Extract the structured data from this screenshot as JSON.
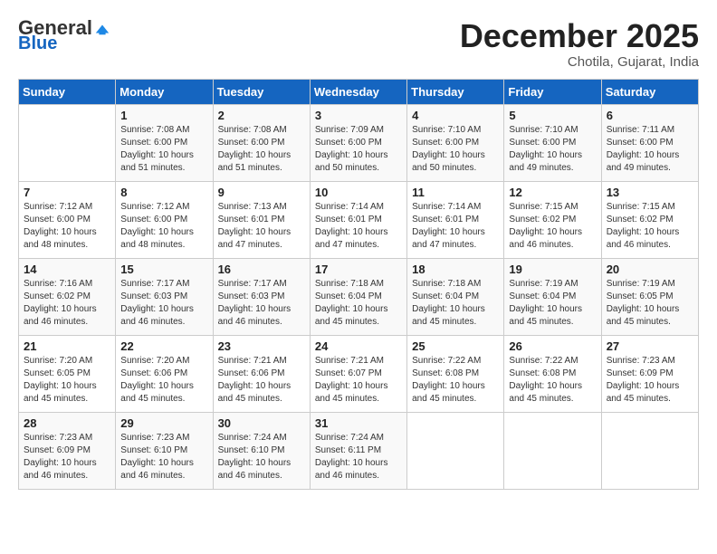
{
  "header": {
    "logo_general": "General",
    "logo_blue": "Blue",
    "month": "December 2025",
    "location": "Chotila, Gujarat, India"
  },
  "weekdays": [
    "Sunday",
    "Monday",
    "Tuesday",
    "Wednesday",
    "Thursday",
    "Friday",
    "Saturday"
  ],
  "weeks": [
    [
      {
        "day": "",
        "sunrise": "",
        "sunset": "",
        "daylight": ""
      },
      {
        "day": "1",
        "sunrise": "7:08 AM",
        "sunset": "6:00 PM",
        "daylight": "10 hours and 51 minutes."
      },
      {
        "day": "2",
        "sunrise": "7:08 AM",
        "sunset": "6:00 PM",
        "daylight": "10 hours and 51 minutes."
      },
      {
        "day": "3",
        "sunrise": "7:09 AM",
        "sunset": "6:00 PM",
        "daylight": "10 hours and 50 minutes."
      },
      {
        "day": "4",
        "sunrise": "7:10 AM",
        "sunset": "6:00 PM",
        "daylight": "10 hours and 50 minutes."
      },
      {
        "day": "5",
        "sunrise": "7:10 AM",
        "sunset": "6:00 PM",
        "daylight": "10 hours and 49 minutes."
      },
      {
        "day": "6",
        "sunrise": "7:11 AM",
        "sunset": "6:00 PM",
        "daylight": "10 hours and 49 minutes."
      }
    ],
    [
      {
        "day": "7",
        "sunrise": "7:12 AM",
        "sunset": "6:00 PM",
        "daylight": "10 hours and 48 minutes."
      },
      {
        "day": "8",
        "sunrise": "7:12 AM",
        "sunset": "6:00 PM",
        "daylight": "10 hours and 48 minutes."
      },
      {
        "day": "9",
        "sunrise": "7:13 AM",
        "sunset": "6:01 PM",
        "daylight": "10 hours and 47 minutes."
      },
      {
        "day": "10",
        "sunrise": "7:14 AM",
        "sunset": "6:01 PM",
        "daylight": "10 hours and 47 minutes."
      },
      {
        "day": "11",
        "sunrise": "7:14 AM",
        "sunset": "6:01 PM",
        "daylight": "10 hours and 47 minutes."
      },
      {
        "day": "12",
        "sunrise": "7:15 AM",
        "sunset": "6:02 PM",
        "daylight": "10 hours and 46 minutes."
      },
      {
        "day": "13",
        "sunrise": "7:15 AM",
        "sunset": "6:02 PM",
        "daylight": "10 hours and 46 minutes."
      }
    ],
    [
      {
        "day": "14",
        "sunrise": "7:16 AM",
        "sunset": "6:02 PM",
        "daylight": "10 hours and 46 minutes."
      },
      {
        "day": "15",
        "sunrise": "7:17 AM",
        "sunset": "6:03 PM",
        "daylight": "10 hours and 46 minutes."
      },
      {
        "day": "16",
        "sunrise": "7:17 AM",
        "sunset": "6:03 PM",
        "daylight": "10 hours and 46 minutes."
      },
      {
        "day": "17",
        "sunrise": "7:18 AM",
        "sunset": "6:04 PM",
        "daylight": "10 hours and 45 minutes."
      },
      {
        "day": "18",
        "sunrise": "7:18 AM",
        "sunset": "6:04 PM",
        "daylight": "10 hours and 45 minutes."
      },
      {
        "day": "19",
        "sunrise": "7:19 AM",
        "sunset": "6:04 PM",
        "daylight": "10 hours and 45 minutes."
      },
      {
        "day": "20",
        "sunrise": "7:19 AM",
        "sunset": "6:05 PM",
        "daylight": "10 hours and 45 minutes."
      }
    ],
    [
      {
        "day": "21",
        "sunrise": "7:20 AM",
        "sunset": "6:05 PM",
        "daylight": "10 hours and 45 minutes."
      },
      {
        "day": "22",
        "sunrise": "7:20 AM",
        "sunset": "6:06 PM",
        "daylight": "10 hours and 45 minutes."
      },
      {
        "day": "23",
        "sunrise": "7:21 AM",
        "sunset": "6:06 PM",
        "daylight": "10 hours and 45 minutes."
      },
      {
        "day": "24",
        "sunrise": "7:21 AM",
        "sunset": "6:07 PM",
        "daylight": "10 hours and 45 minutes."
      },
      {
        "day": "25",
        "sunrise": "7:22 AM",
        "sunset": "6:08 PM",
        "daylight": "10 hours and 45 minutes."
      },
      {
        "day": "26",
        "sunrise": "7:22 AM",
        "sunset": "6:08 PM",
        "daylight": "10 hours and 45 minutes."
      },
      {
        "day": "27",
        "sunrise": "7:23 AM",
        "sunset": "6:09 PM",
        "daylight": "10 hours and 45 minutes."
      }
    ],
    [
      {
        "day": "28",
        "sunrise": "7:23 AM",
        "sunset": "6:09 PM",
        "daylight": "10 hours and 46 minutes."
      },
      {
        "day": "29",
        "sunrise": "7:23 AM",
        "sunset": "6:10 PM",
        "daylight": "10 hours and 46 minutes."
      },
      {
        "day": "30",
        "sunrise": "7:24 AM",
        "sunset": "6:10 PM",
        "daylight": "10 hours and 46 minutes."
      },
      {
        "day": "31",
        "sunrise": "7:24 AM",
        "sunset": "6:11 PM",
        "daylight": "10 hours and 46 minutes."
      },
      {
        "day": "",
        "sunrise": "",
        "sunset": "",
        "daylight": ""
      },
      {
        "day": "",
        "sunrise": "",
        "sunset": "",
        "daylight": ""
      },
      {
        "day": "",
        "sunrise": "",
        "sunset": "",
        "daylight": ""
      }
    ]
  ]
}
